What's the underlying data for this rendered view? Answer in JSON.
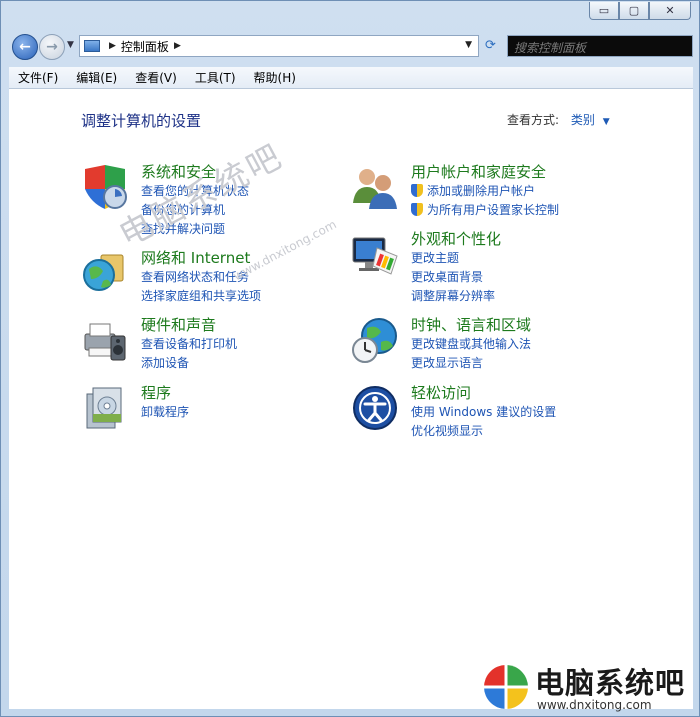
{
  "window": {
    "minimize": "▭",
    "maximize": "▢",
    "close": "✕"
  },
  "address": {
    "path": "控制面板",
    "search_placeholder": "搜索控制面板"
  },
  "menu": [
    "文件(F)",
    "编辑(E)",
    "查看(V)",
    "工具(T)",
    "帮助(H)"
  ],
  "header": {
    "title": "调整计算机的设置",
    "view_by_label": "查看方式:",
    "view_by_value": "类别"
  },
  "categories": [
    {
      "title": "系统和安全",
      "icon": "system-security-icon",
      "links": [
        "查看您的计算机状态",
        "备份您的计算机",
        "查找并解决问题"
      ]
    },
    {
      "title": "网络和 Internet",
      "icon": "network-globe-icon",
      "links": [
        "查看网络状态和任务",
        "选择家庭组和共享选项"
      ]
    },
    {
      "title": "硬件和声音",
      "icon": "printer-speaker-icon",
      "links": [
        "查看设备和打印机",
        "添加设备"
      ]
    },
    {
      "title": "程序",
      "icon": "programs-icon",
      "links": [
        "卸载程序"
      ]
    },
    {
      "title": "用户帐户和家庭安全",
      "icon": "users-icon",
      "links": [
        "添加或删除用户帐户",
        "为所有用户设置家长控制"
      ]
    },
    {
      "title": "外观和个性化",
      "icon": "monitor-palette-icon",
      "links": [
        "更改主题",
        "更改桌面背景",
        "调整屏幕分辨率"
      ]
    },
    {
      "title": "时钟、语言和区域",
      "icon": "clock-globe-icon",
      "links": [
        "更改键盘或其他输入法",
        "更改显示语言"
      ]
    },
    {
      "title": "轻松访问",
      "icon": "ease-of-access-icon",
      "links": [
        "使用 Windows 建议的设置",
        "优化视频显示"
      ]
    }
  ],
  "watermark": {
    "brand": "电脑系统吧",
    "url": "www.dnxitong.com"
  }
}
